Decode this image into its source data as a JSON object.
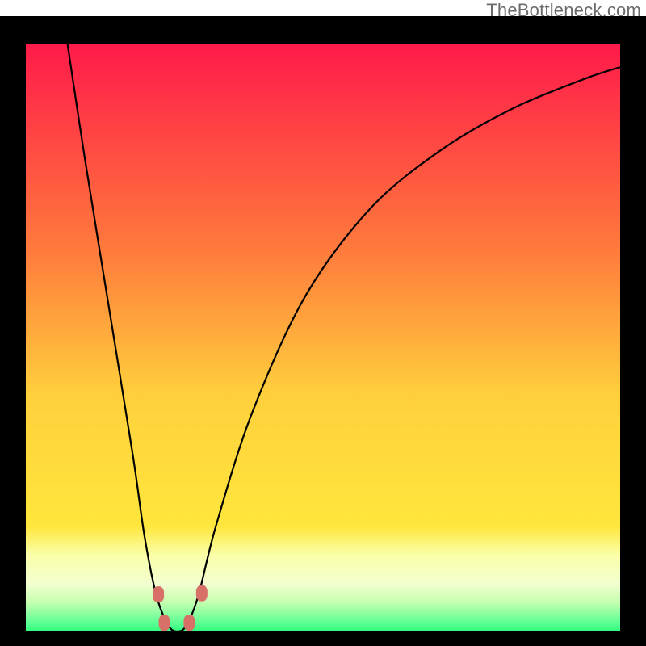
{
  "attribution": "TheBottleneck.com",
  "chart_data": {
    "type": "line",
    "title": "",
    "xlabel": "",
    "ylabel": "",
    "xlim": [
      0,
      100
    ],
    "ylim": [
      0,
      100
    ],
    "background_gradient": {
      "top": "#ff1a4a",
      "mid_upper": "#ffa43c",
      "mid_lower": "#ffe63c",
      "bottom_band_top": "#f9ff8a",
      "bottom_band_bottom": "#36ff7f"
    },
    "series": [
      {
        "name": "bottleneck-curve",
        "x": [
          7,
          10,
          14,
          18,
          20,
          22,
          24,
          25.5,
          27,
          29,
          32,
          38,
          47,
          58,
          70,
          82,
          94,
          100
        ],
        "y": [
          100,
          80,
          55,
          30,
          16,
          6,
          1,
          0,
          1,
          6,
          18,
          37,
          57,
          72,
          82,
          89,
          94,
          96
        ]
      }
    ],
    "markers": [
      {
        "name": "left-shoulder-upper",
        "x": 22.3,
        "y": 6.3
      },
      {
        "name": "left-shoulder-lower",
        "x": 23.3,
        "y": 1.5
      },
      {
        "name": "right-shoulder-lower",
        "x": 27.5,
        "y": 1.5
      },
      {
        "name": "right-shoulder-upper",
        "x": 29.6,
        "y": 6.5
      }
    ],
    "green_band": {
      "y_start": 0.3,
      "y_end": 2.4
    },
    "pale_band": {
      "y_start": 2.4,
      "y_end": 13
    }
  }
}
